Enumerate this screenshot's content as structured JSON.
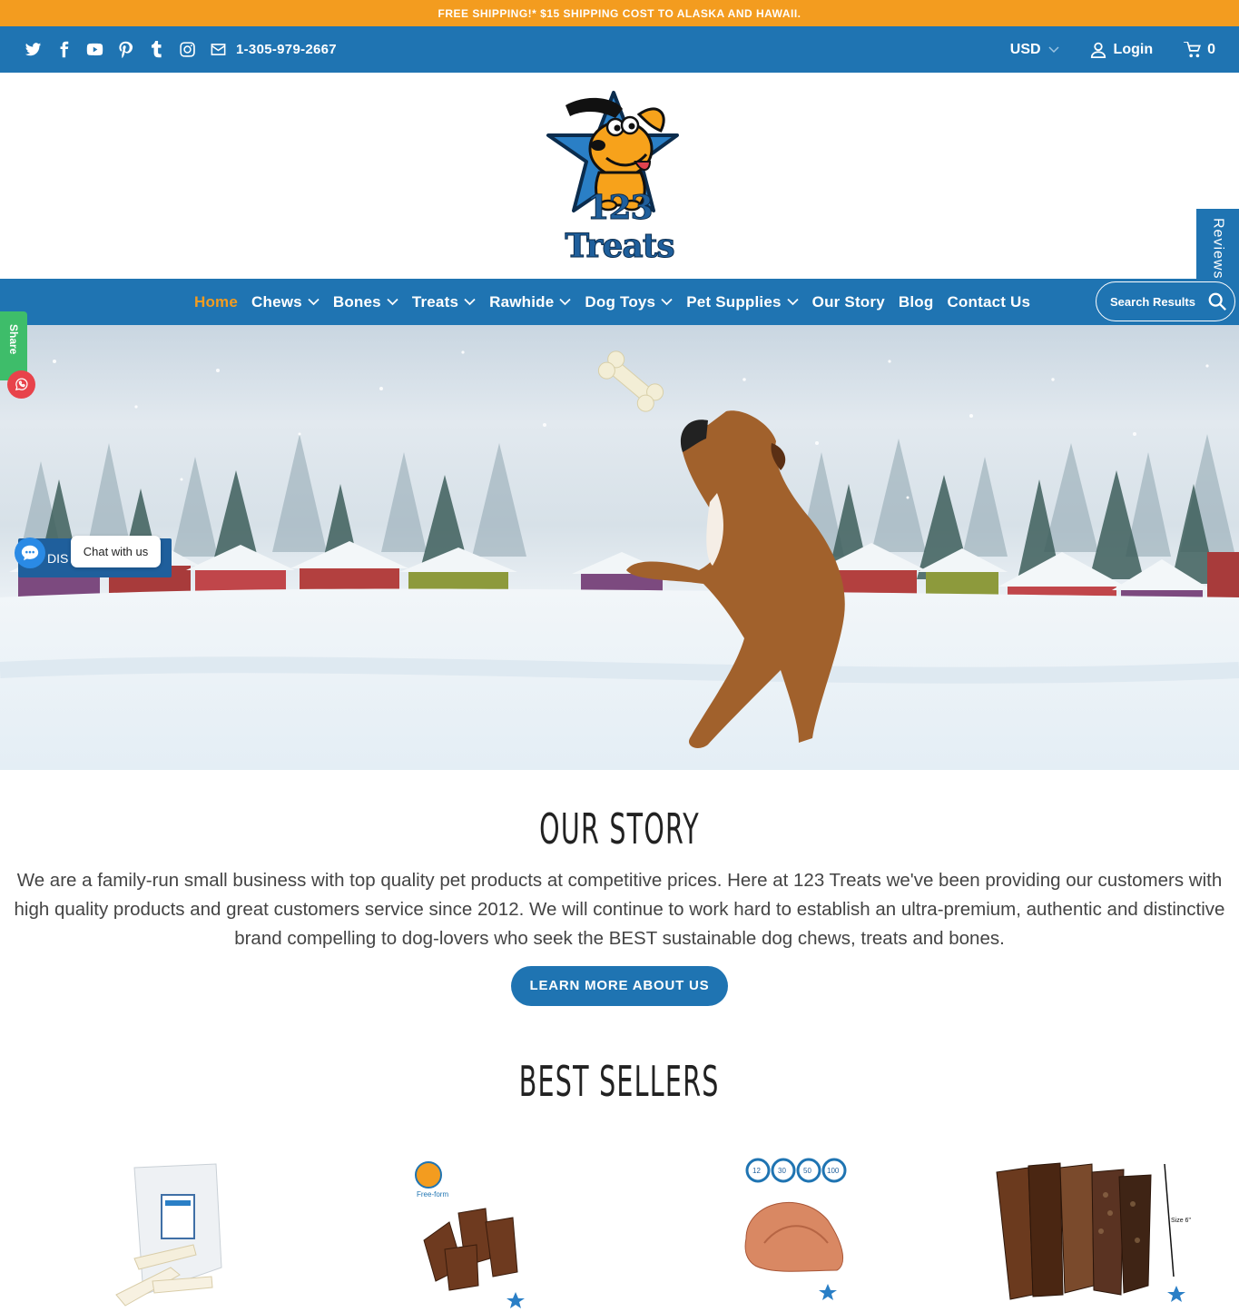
{
  "announcement": "FREE SHIPPING!* $15 SHIPPING COST TO ALASKA AND HAWAII.",
  "topbar": {
    "social_icons": [
      "twitter-icon",
      "facebook-icon",
      "youtube-icon",
      "pinterest-icon",
      "tumblr-icon",
      "instagram-icon",
      "mail-icon"
    ],
    "phone": "1-305-979-2667",
    "currency": "USD",
    "login": "Login",
    "cart_count": "0"
  },
  "logo": {
    "text": "123 Treats"
  },
  "reviews_tab": "Reviews",
  "nav": {
    "items": [
      {
        "label": "Home",
        "active": true,
        "dropdown": false
      },
      {
        "label": "Chews",
        "dropdown": true
      },
      {
        "label": "Bones",
        "dropdown": true
      },
      {
        "label": "Treats",
        "dropdown": true
      },
      {
        "label": "Rawhide",
        "dropdown": true
      },
      {
        "label": "Dog Toys",
        "dropdown": true
      },
      {
        "label": "Pet Supplies",
        "dropdown": true
      },
      {
        "label": "Our Story",
        "dropdown": false
      },
      {
        "label": "Blog",
        "dropdown": false
      },
      {
        "label": "Contact Us",
        "dropdown": false
      }
    ],
    "search_placeholder": "Search Results"
  },
  "widgets": {
    "share": "Share",
    "chat_label": "Chat with us",
    "discount_partial": "DIS"
  },
  "story": {
    "title": "OUR STORY",
    "body": "We are a family-run small business with top quality pet products at competitive prices. Here at 123 Treats we've been providing our customers with high quality products and great customers service since 2012. We will continue to work hard to establish an ultra-premium, authentic and distinctive brand compelling to dog-lovers who seek the BEST sustainable dog chews, treats and bones.",
    "button": "LEARN MORE ABOUT US"
  },
  "best_sellers": {
    "title": "BEST SELLERS",
    "product_badges": {
      "p2_badge": "Free-form",
      "p3_sizes": [
        "12",
        "30",
        "50",
        "100"
      ],
      "p4_size": "Size 6\""
    }
  },
  "colors": {
    "brand_blue": "#1f74b2",
    "accent_orange": "#f39c1f",
    "share_green": "#3ebd6a"
  }
}
